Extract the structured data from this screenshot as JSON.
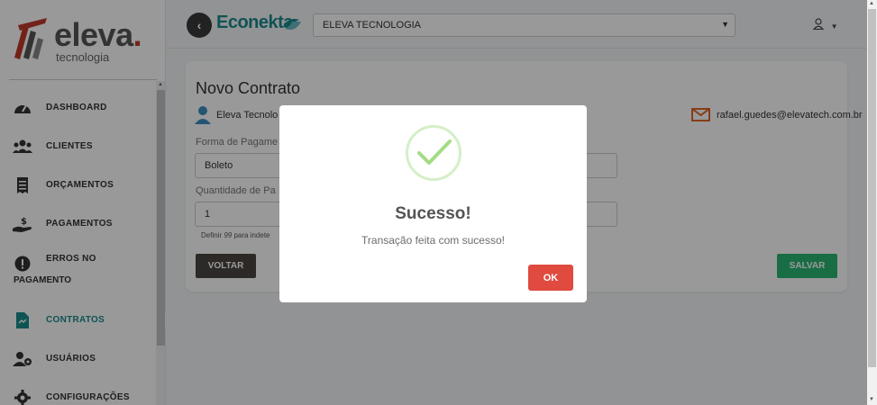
{
  "brand": {
    "logo_word": "eleva",
    "logo_dot": ".",
    "logo_sub": "tecnologia",
    "app_name": "Econekta"
  },
  "sidebar": {
    "items": [
      {
        "label": "DASHBOARD",
        "icon": "gauge-icon"
      },
      {
        "label": "CLIENTES",
        "icon": "users-icon"
      },
      {
        "label": "ORÇAMENTOS",
        "icon": "receipt-icon"
      },
      {
        "label": "PAGAMENTOS",
        "icon": "hand-dollar-icon"
      },
      {
        "label": "ERROS NO",
        "label2": "PAGAMENTO",
        "icon": "exclamation-icon"
      },
      {
        "label": "CONTRATOS",
        "icon": "contract-file-icon",
        "active": true
      },
      {
        "label": "USUÁRIOS",
        "icon": "user-gear-icon"
      },
      {
        "label": "CONFIGURAÇÕES",
        "icon": "cog-icon"
      }
    ]
  },
  "header": {
    "company_select": "ELEVA TECNOLOGIA"
  },
  "main": {
    "title": "Novo Contrato",
    "client_name": "Eleva Tecnolo",
    "email": "rafael.guedes@elevatech.com.br",
    "payment_label": "Forma de Pagame",
    "payment_value": "Boleto",
    "quantity_label": "Quantidade de Pa",
    "quantity_value": "1",
    "hint_prefix": "Definir ",
    "hint_num": "99",
    "hint_suffix": " para indete",
    "back_label": "VOLTAR",
    "save_label": "SALVAR"
  },
  "modal": {
    "title": "Sucesso!",
    "message": "Transação feita com sucesso!",
    "ok_label": "OK"
  },
  "colors": {
    "accent": "#1a8a8c",
    "success": "#a5dc86",
    "danger": "#e04a3f",
    "save": "#2bb673"
  }
}
